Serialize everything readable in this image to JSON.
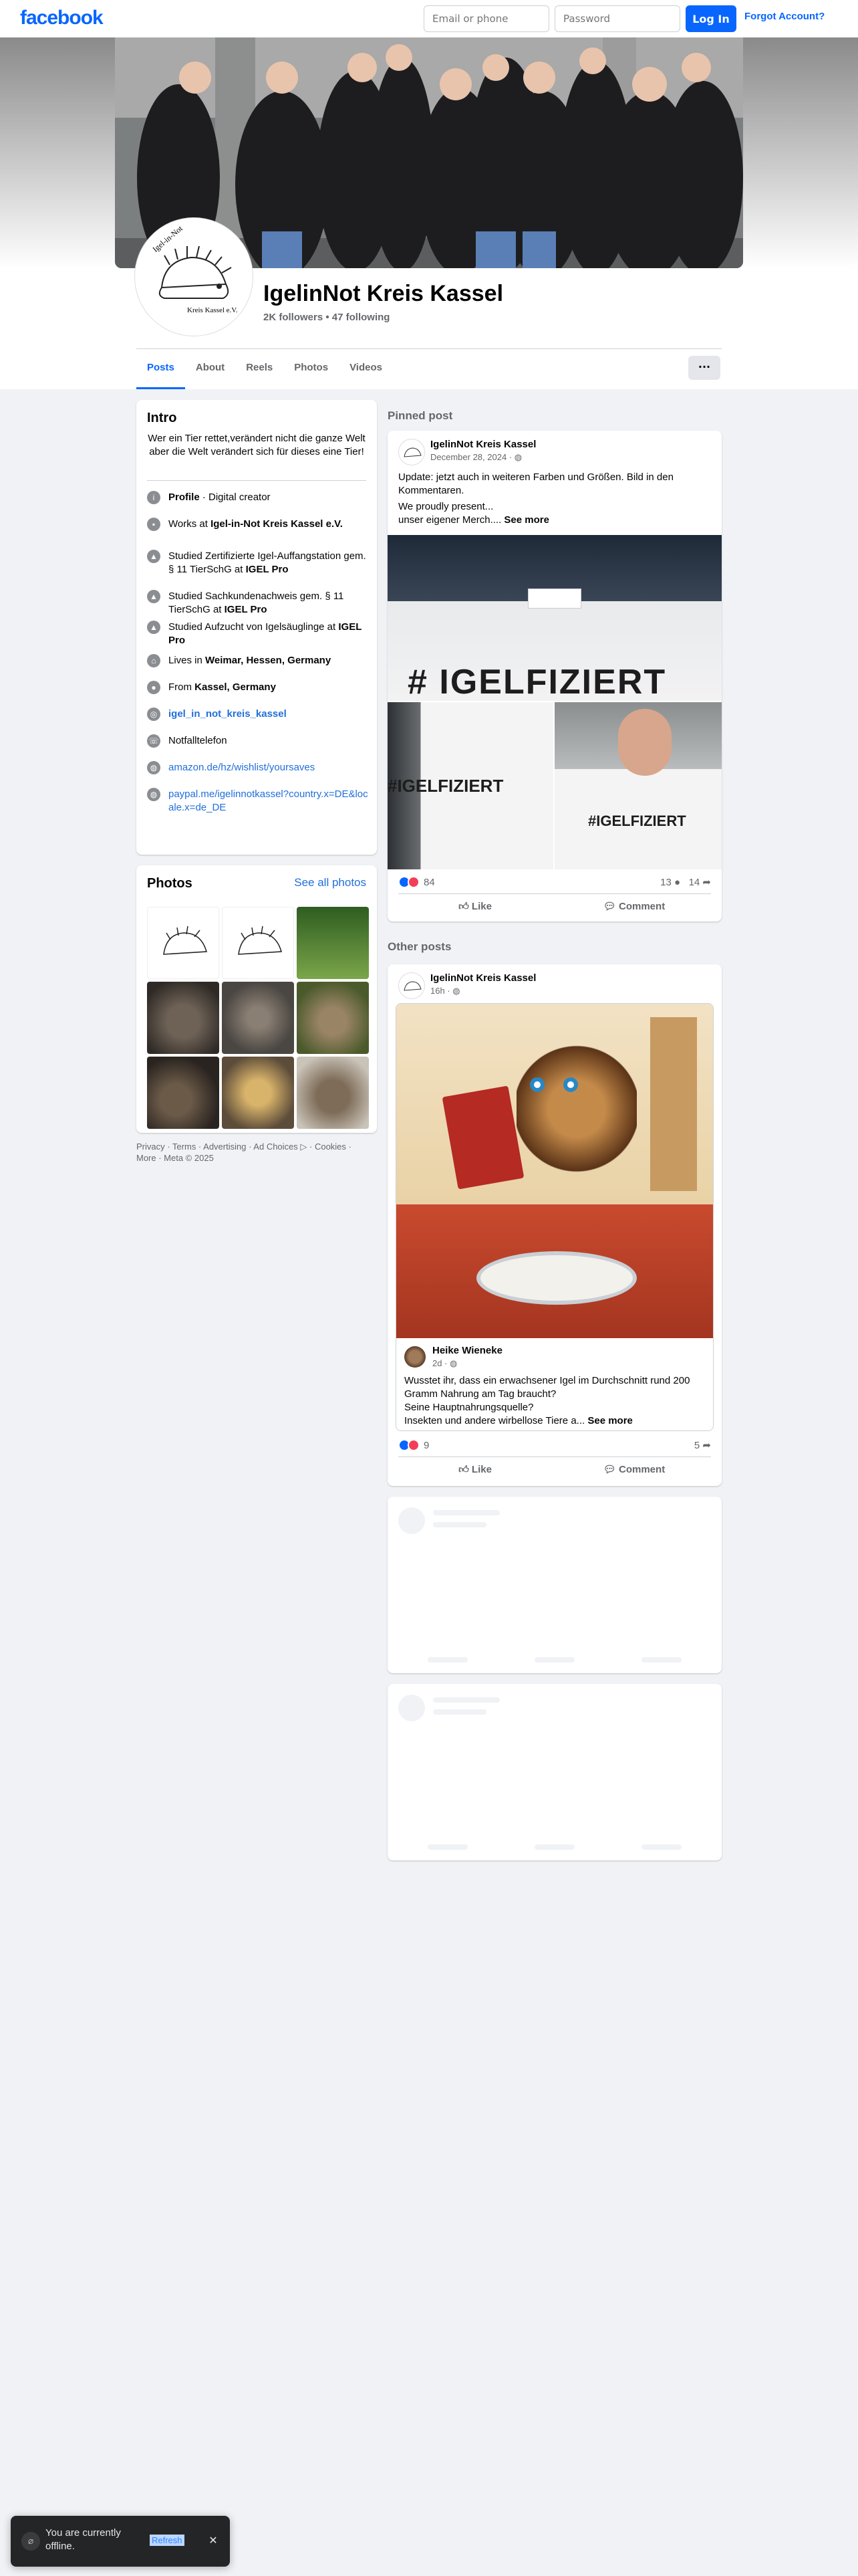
{
  "topbar": {
    "logo": "facebook",
    "email_placeholder": "Email or phone",
    "password_placeholder": "Password",
    "login_label": "Log In",
    "forgot_label": "Forgot Account?"
  },
  "profile": {
    "name": "IgelinNot Kreis Kassel",
    "stats": "2K followers • 47 following",
    "logo_text_top": "Igel-in-Not",
    "logo_text_bottom": "Kreis Kassel e.V."
  },
  "tabs": [
    "Posts",
    "About",
    "Reels",
    "Photos",
    "Videos"
  ],
  "more_label": "···",
  "intro": {
    "title": "Intro",
    "bio": "Wer ein Tier rettet,verändert nicht die ganze Welt aber die Welt verändert sich für dieses eine Tier!",
    "rows": [
      {
        "icon": "info-icon",
        "pre": "",
        "bold": "Profile",
        "post": " · Digital creator"
      },
      {
        "icon": "briefcase-icon",
        "pre": "Works at ",
        "bold": "Igel-in-Not Kreis Kassel e.V.",
        "post": ""
      },
      {
        "icon": "graduation-cap-icon",
        "pre": "Studied Zertifizierte Igel-Auffangstation gem. § 11 TierSchG at ",
        "bold": "IGEL Pro",
        "post": ""
      },
      {
        "icon": "graduation-cap-icon",
        "pre": "Studied Sachkundenachweis gem. § 11 TierSchG at ",
        "bold": "IGEL Pro",
        "post": ""
      },
      {
        "icon": "graduation-cap-icon",
        "pre": "Studied Aufzucht von Igelsäuglinge at ",
        "bold": "IGEL Pro",
        "post": ""
      },
      {
        "icon": "home-icon",
        "pre": "Lives in ",
        "bold": "Weimar, Hessen, Germany",
        "post": ""
      },
      {
        "icon": "location-pin-icon",
        "pre": "From ",
        "bold": "Kassel, Germany",
        "post": ""
      },
      {
        "icon": "instagram-icon",
        "pre": "",
        "bold": "",
        "post": "",
        "link": "igel_in_not_kreis_kassel"
      },
      {
        "icon": "whatsapp-icon",
        "pre": "Notfalltelefon",
        "bold": "",
        "post": ""
      },
      {
        "icon": "globe-icon",
        "pre": "",
        "bold": "",
        "post": "",
        "link": "amazon.de/hz/wishlist/yoursaves"
      },
      {
        "icon": "globe-icon",
        "pre": "",
        "bold": "",
        "post": "",
        "link": "paypal.me/igelinnotkassel?country.x=DE&locale.x=de_DE"
      }
    ]
  },
  "photos": {
    "title": "Photos",
    "see_all": "See all photos"
  },
  "footer": {
    "links": "Privacy · Terms · Advertising · Ad Choices ▷ · Cookies · More · Meta © 2025"
  },
  "pinned": {
    "label": "Pinned post",
    "author": "IgelinNot Kreis Kassel",
    "date": "December 28, 2024 · ",
    "text1": "Update: jetzt auch in weiteren Farben und Größen. Bild in den Kommentaren.",
    "text2": "We proudly present...",
    "text3": "unser eigener Merch.... ",
    "see_more": "See more",
    "shirt_text": "# IGELFIZIERT",
    "shirt_text_small": "#IGELFIZIERT",
    "reactions": "84",
    "comments": "13",
    "shares": "14",
    "like": "Like",
    "comment": "Comment"
  },
  "other": {
    "label": "Other posts",
    "author": "IgelinNot Kreis Kassel",
    "date": "16h · ",
    "shared_author": "Heike Wieneke",
    "shared_date": "2d · ",
    "text1": "Wusstet ihr, dass ein erwachsener Igel im Durchschnitt rund 200 Gramm Nahrung am Tag braucht?",
    "text2": "Seine Hauptnahrungsquelle?",
    "text3": "Insekten und andere wirbellose Tiere a... ",
    "see_more": "See more",
    "reactions": "9",
    "shares": "5",
    "like": "Like",
    "comment": "Comment"
  },
  "toast": {
    "message": "You are currently offline.",
    "refresh": "Refresh"
  },
  "colors": {
    "brand": "#0866ff",
    "link": "#216fdb"
  }
}
